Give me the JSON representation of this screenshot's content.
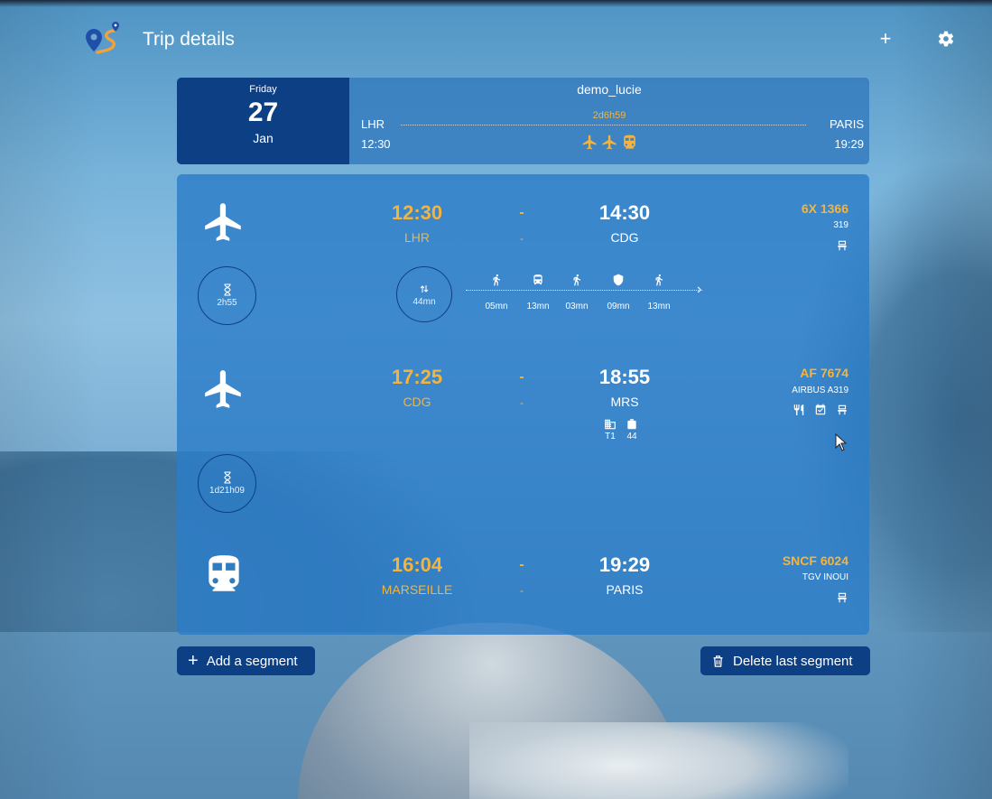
{
  "app": {
    "title": "Trip details"
  },
  "header": {
    "add_icon": "plus-icon",
    "settings_icon": "gear-icon"
  },
  "summary": {
    "day_of_week": "Friday",
    "day": "27",
    "month": "Jan",
    "trip_name": "demo_lucie",
    "duration": "2d6h59",
    "from": "LHR",
    "from_time": "12:30",
    "to": "PARIS",
    "to_time": "19:29",
    "modes": [
      "plane-icon",
      "plane-icon",
      "train-icon"
    ]
  },
  "segments": [
    {
      "mode": "plane-icon",
      "dep_time": "12:30",
      "dep_place": "LHR",
      "arr_time": "14:30",
      "arr_place": "CDG",
      "flight_no": "6X 1366",
      "aircraft": "319",
      "amenities": [
        "seat-icon"
      ]
    },
    {
      "mode": "plane-icon",
      "dep_time": "17:25",
      "dep_place": "CDG",
      "arr_time": "18:55",
      "arr_place": "MRS",
      "flight_no": "AF 7674",
      "aircraft": "AIRBUS A319",
      "amenities": [
        "meal-icon",
        "checkin-icon",
        "seat-icon"
      ],
      "terminal": "T1",
      "gate": "44"
    },
    {
      "mode": "train-icon",
      "dep_time": "16:04",
      "dep_place": "MARSEILLE",
      "arr_time": "19:29",
      "arr_place": "PARIS",
      "flight_no": "SNCF 6024",
      "aircraft": "TGV INOUI",
      "amenities": [
        "seat-icon"
      ]
    }
  ],
  "waits": {
    "first": "2h55",
    "second": "1d21h09"
  },
  "connection": {
    "total": "44mn",
    "steps": [
      {
        "icon": "walk-icon",
        "time": "05mn"
      },
      {
        "icon": "bus-icon",
        "time": "13mn"
      },
      {
        "icon": "walk-icon",
        "time": "03mn"
      },
      {
        "icon": "security-icon",
        "time": "09mn"
      },
      {
        "icon": "walk-icon",
        "time": "13mn"
      }
    ]
  },
  "actions": {
    "add_segment": "Add a segment",
    "delete_last": "Delete last segment"
  },
  "colors": {
    "accent": "#f3b43f",
    "dark_blue": "#0d3f85",
    "card": "#2c7cc8"
  }
}
